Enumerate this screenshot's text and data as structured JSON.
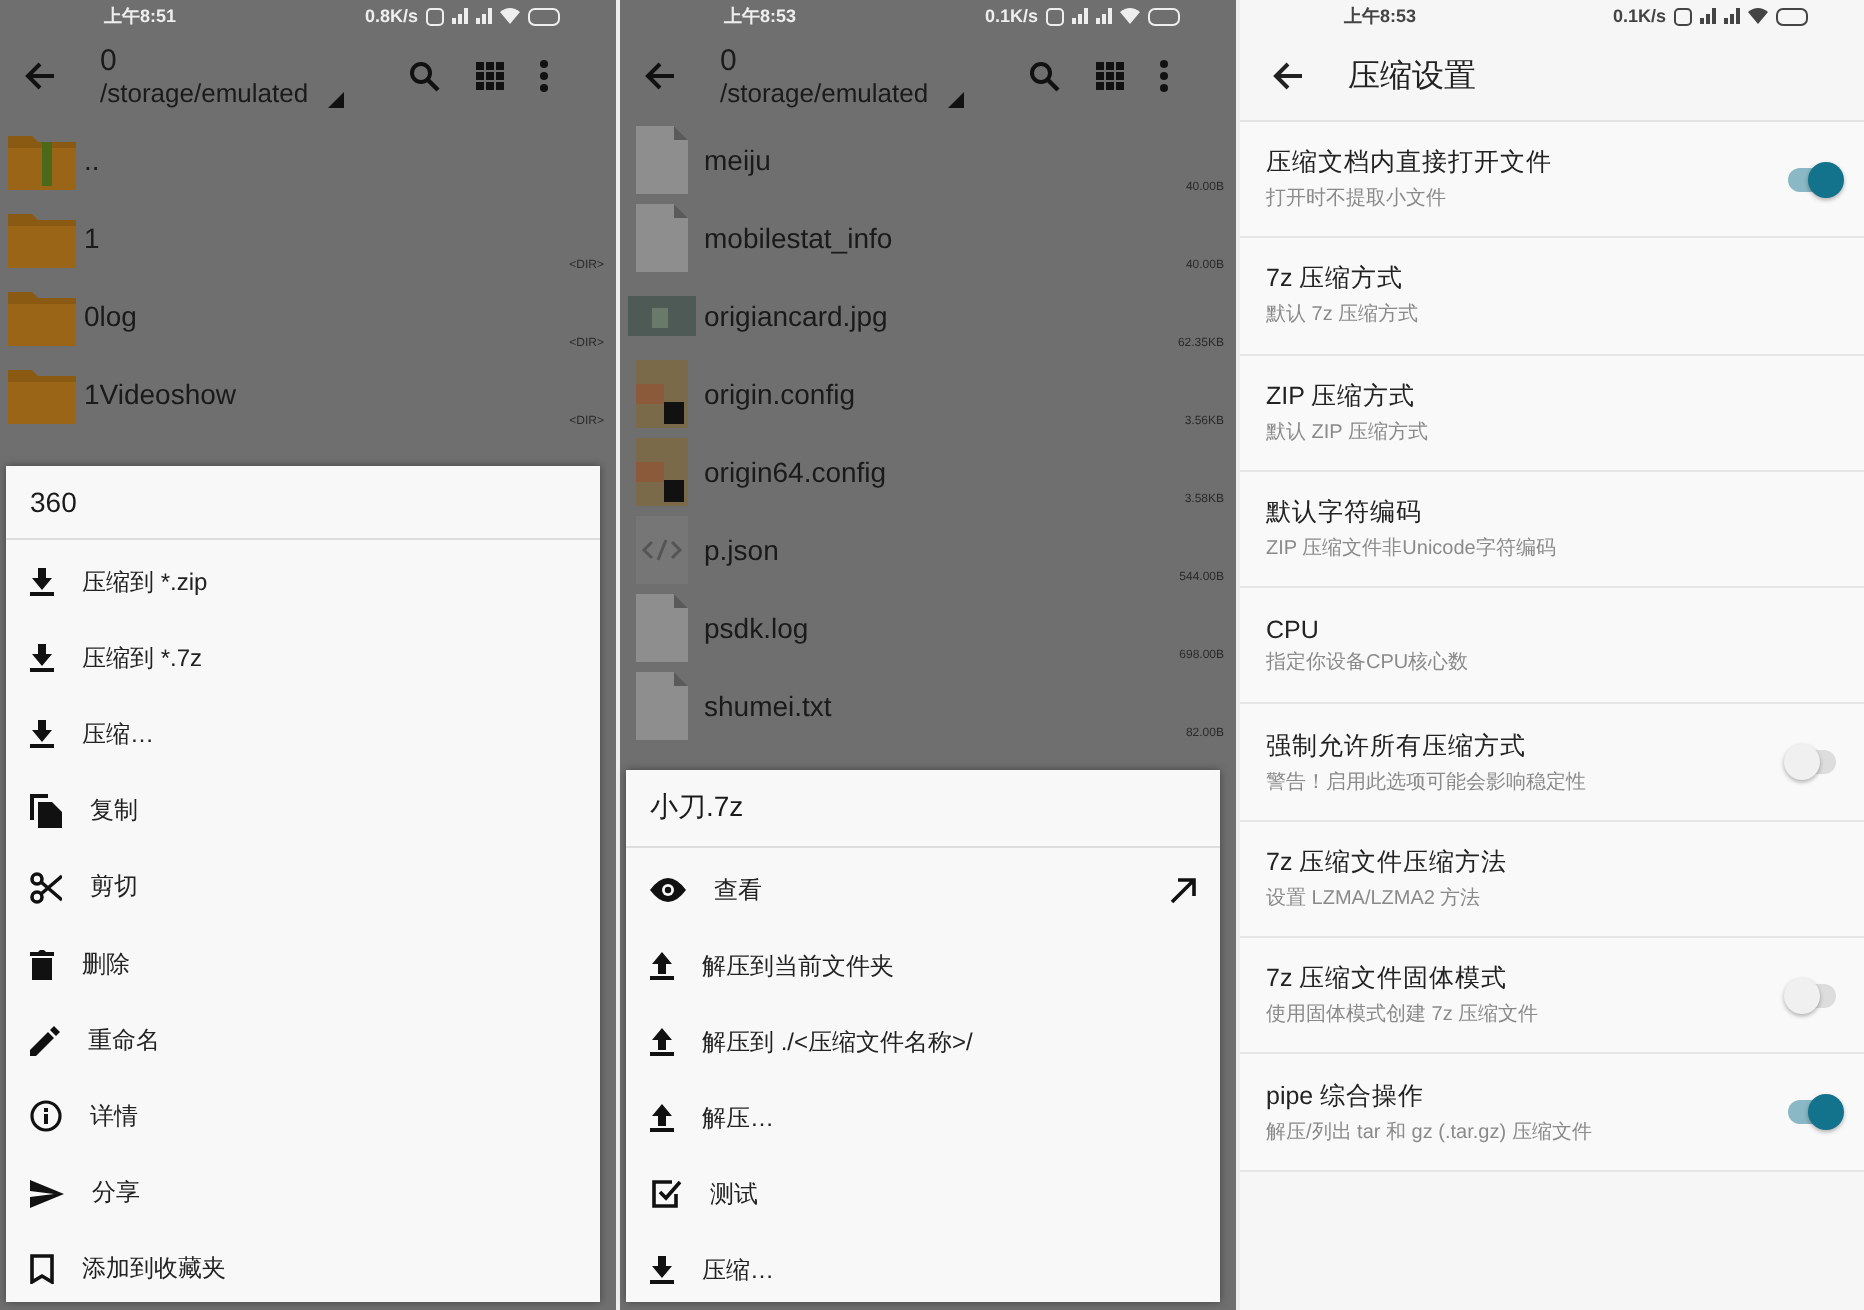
{
  "panels": [
    {
      "kind": "file_browser",
      "status_bar": {
        "time": "上午8:51",
        "speed": "0.8K/s"
      },
      "toolbar": {
        "title": "0",
        "path": "/storage/emulated"
      },
      "files": [
        {
          "kind": "parent_folder",
          "name": ".."
        },
        {
          "kind": "folder",
          "name": "1",
          "size": "<DIR>"
        },
        {
          "kind": "folder",
          "name": "0log",
          "size": "<DIR>"
        },
        {
          "kind": "folder",
          "name": "1Videoshow",
          "size": "<DIR>"
        }
      ],
      "menu": {
        "title": "360",
        "items": [
          {
            "kind": "compress",
            "label": "压缩到 *.zip"
          },
          {
            "kind": "compress",
            "label": "压缩到 *.7z"
          },
          {
            "kind": "compress",
            "label": "压缩…"
          },
          {
            "kind": "copy",
            "label": "复制"
          },
          {
            "kind": "cut",
            "label": "剪切"
          },
          {
            "kind": "delete",
            "label": "删除"
          },
          {
            "kind": "rename",
            "label": "重命名"
          },
          {
            "kind": "info",
            "label": "详情"
          },
          {
            "kind": "share",
            "label": "分享"
          },
          {
            "kind": "bookmark",
            "label": "添加到收藏夹"
          }
        ]
      }
    },
    {
      "kind": "file_browser",
      "status_bar": {
        "time": "上午8:53",
        "speed": "0.1K/s"
      },
      "toolbar": {
        "title": "0",
        "path": "/storage/emulated"
      },
      "files": [
        {
          "kind": "file",
          "name": "meiju",
          "size": "40.00B"
        },
        {
          "kind": "file",
          "name": "mobilestat_info",
          "size": "40.00B"
        },
        {
          "kind": "image",
          "name": "origiancard.jpg",
          "size": "62.35KB"
        },
        {
          "kind": "unknown",
          "name": "origin.config",
          "size": "3.56KB"
        },
        {
          "kind": "unknown",
          "name": "origin64.config",
          "size": "3.58KB"
        },
        {
          "kind": "code",
          "name": "p.json",
          "size": "544.00B"
        },
        {
          "kind": "file",
          "name": "psdk.log",
          "size": "698.00B"
        },
        {
          "kind": "file",
          "name": "shumei.txt",
          "size": "82.00B"
        }
      ],
      "menu": {
        "title": "小刀.7z",
        "items": [
          {
            "kind": "view",
            "label": "查看"
          },
          {
            "kind": "extract",
            "label": "解压到当前文件夹"
          },
          {
            "kind": "extract",
            "label": "解压到 ./<压缩文件名称>/"
          },
          {
            "kind": "extract",
            "label": "解压…"
          },
          {
            "kind": "test",
            "label": "测试"
          },
          {
            "kind": "compress",
            "label": "压缩…"
          }
        ]
      }
    },
    {
      "kind": "settings",
      "status_bar": {
        "time": "上午8:53",
        "speed": "0.1K/s"
      },
      "title": "压缩设置",
      "settings": [
        {
          "kind": "toggle",
          "title": "压缩文档内直接打开文件",
          "subtitle": "打开时不提取小文件",
          "on": true
        },
        {
          "kind": "plain",
          "title": "7z 压缩方式",
          "subtitle": "默认 7z 压缩方式"
        },
        {
          "kind": "plain",
          "title": "ZIP 压缩方式",
          "subtitle": "默认 ZIP 压缩方式"
        },
        {
          "kind": "plain",
          "title": "默认字符编码",
          "subtitle": "ZIP 压缩文件非Unicode字符编码"
        },
        {
          "kind": "plain",
          "title": "CPU",
          "subtitle": "指定你设备CPU核心数"
        },
        {
          "kind": "toggle",
          "title": "强制允许所有压缩方式",
          "subtitle": "警告！启用此选项可能会影响稳定性",
          "on": false
        },
        {
          "kind": "plain",
          "title": "7z 压缩文件压缩方法",
          "subtitle": "设置 LZMA/LZMA2 方法"
        },
        {
          "kind": "toggle",
          "title": "7z 压缩文件固体模式",
          "subtitle": "使用固体模式创建 7z 压缩文件",
          "on": false
        },
        {
          "kind": "toggle",
          "title": "pipe 综合操作",
          "subtitle": "解压/列出 tar 和 gz (.tar.gz) 压缩文件",
          "on": true
        }
      ]
    }
  ]
}
